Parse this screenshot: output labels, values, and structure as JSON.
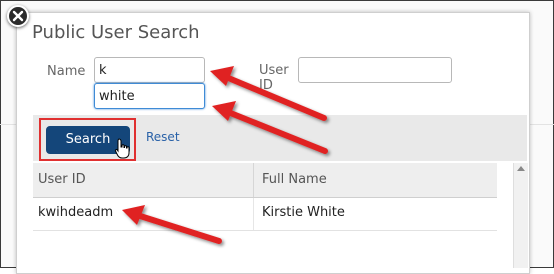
{
  "dialog": {
    "title": "Public User Search"
  },
  "form": {
    "name_label": "Name",
    "first_name_value": "k",
    "last_name_value": "white",
    "userid_label": "User ID",
    "userid_value": ""
  },
  "buttons": {
    "search_label": "Search",
    "reset_label": "Reset"
  },
  "table": {
    "columns": [
      "User ID",
      "Full Name"
    ],
    "rows": [
      {
        "user_id": "kwihdeadm",
        "full_name": "Kirstie White"
      }
    ]
  },
  "icons": {
    "close": "close-icon",
    "cursor": "hand-pointer-icon",
    "scroll_up": "scroll-up-arrow-icon",
    "annotation": "red-arrow-icon"
  },
  "colors": {
    "primary_button": "#14467a",
    "link": "#2a62a8",
    "annotation": "#e02020",
    "focus": "#3f8bd6"
  }
}
